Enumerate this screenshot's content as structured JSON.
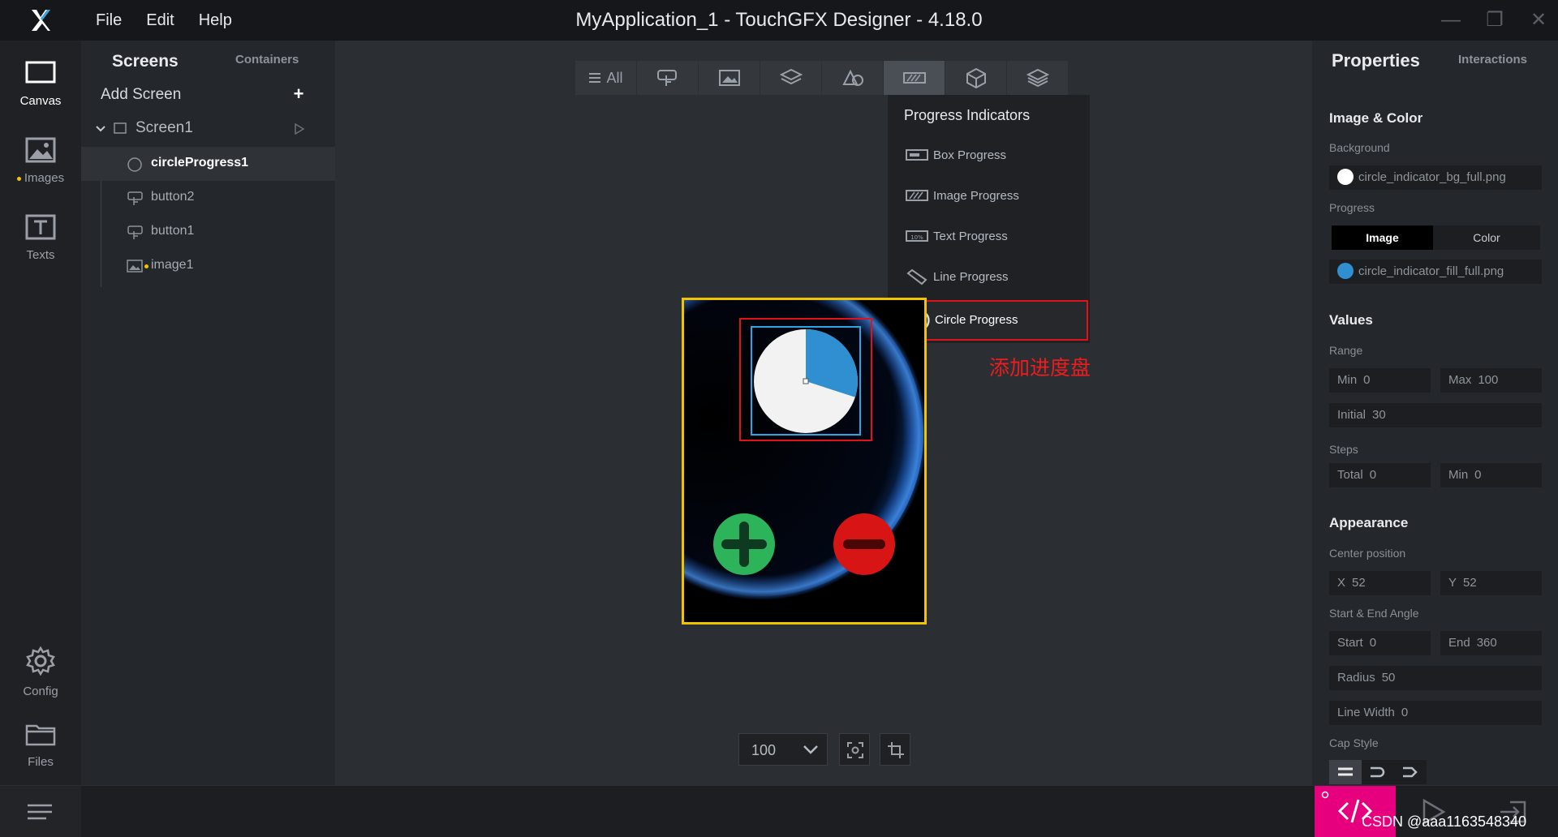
{
  "app": {
    "title": "MyApplication_1 - TouchGFX Designer - 4.18.0",
    "menu": [
      "File",
      "Edit",
      "Help"
    ]
  },
  "leftnav": {
    "items": [
      {
        "label": "Canvas",
        "icon": "canvas-icon"
      },
      {
        "label": "Images",
        "icon": "images-icon"
      },
      {
        "label": "Texts",
        "icon": "texts-icon"
      },
      {
        "label": "Config",
        "icon": "gear-icon"
      },
      {
        "label": "Files",
        "icon": "folder-icon"
      }
    ]
  },
  "screens_panel": {
    "tab_screens": "Screens",
    "tab_containers": "Containers",
    "add_screen": "Add Screen",
    "add_icon": "+",
    "screen_name": "Screen1",
    "widgets": [
      {
        "name": "circleProgress1",
        "icon": "circle-progress-icon",
        "selected": true
      },
      {
        "name": "button2",
        "icon": "button-icon"
      },
      {
        "name": "button1",
        "icon": "button-icon"
      },
      {
        "name": "image1",
        "icon": "image-icon"
      }
    ]
  },
  "toolbar": {
    "all_label": "All",
    "groups": [
      "buttons",
      "images",
      "containers",
      "shapes",
      "progress-indicators",
      "3d",
      "layers"
    ]
  },
  "dropdown": {
    "title": "Progress Indicators",
    "items": [
      "Box Progress",
      "Image Progress",
      "Text Progress",
      "Line Progress",
      "Circle Progress"
    ],
    "highlighted": "Circle Progress"
  },
  "annotation": "添加进度盘",
  "canvas": {
    "zoom": "100",
    "circle_progress_value": 0.3
  },
  "properties": {
    "tab_properties": "Properties",
    "tab_interactions": "Interactions",
    "image_color": {
      "section": "Image & Color",
      "background_label": "Background",
      "background_value": "circle_indicator_bg_full.png",
      "progress_label": "Progress",
      "seg_image": "Image",
      "seg_color": "Color",
      "progress_value": "circle_indicator_fill_full.png"
    },
    "values": {
      "section": "Values",
      "range_label": "Range",
      "min_k": "Min",
      "min_v": "0",
      "max_k": "Max",
      "max_v": "100",
      "initial_k": "Initial",
      "initial_v": "30",
      "steps_label": "Steps",
      "total_k": "Total",
      "total_v": "0",
      "smin_k": "Min",
      "smin_v": "0"
    },
    "appearance": {
      "section": "Appearance",
      "center_label": "Center position",
      "x_k": "X",
      "x_v": "52",
      "y_k": "Y",
      "y_v": "52",
      "angle_label": "Start & End Angle",
      "start_k": "Start",
      "start_v": "0",
      "end_k": "End",
      "end_v": "360",
      "radius_k": "Radius",
      "radius_v": "50",
      "linewidth_k": "Line Width",
      "linewidth_v": "0",
      "cap_label": "Cap Style"
    }
  },
  "watermark": "CSDN @aaa1163548340",
  "colors": {
    "accent_pink": "#e6007e",
    "highlight_red": "#e0131a",
    "device_border": "#f2c400"
  }
}
